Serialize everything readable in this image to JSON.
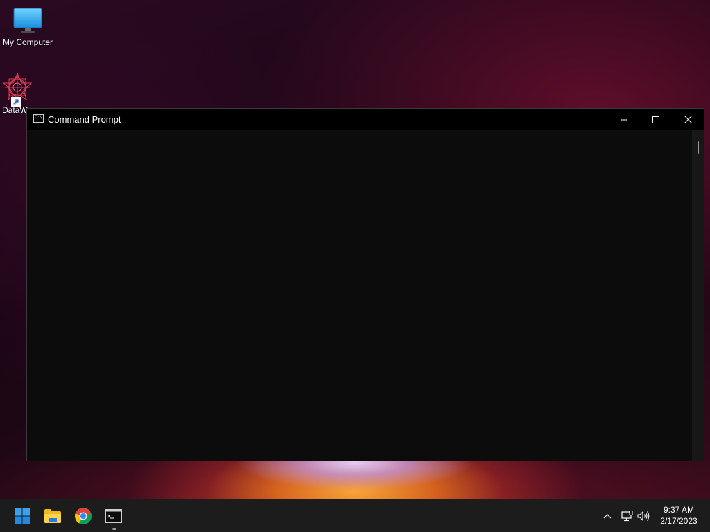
{
  "desktop": {
    "icons": [
      {
        "label": "My Computer",
        "icon": "monitor-icon"
      },
      {
        "label": "DataW",
        "icon": "datawarrior-icon"
      }
    ]
  },
  "window": {
    "title": "Command Prompt",
    "icon": "cmd-icon",
    "icon_text": "C:\\.",
    "buttons": {
      "minimize": "minimize-icon",
      "maximize": "maximize-icon",
      "close": "close-icon"
    }
  },
  "taskbar": {
    "items": [
      {
        "name": "Start",
        "icon": "windows-logo-icon"
      },
      {
        "name": "File Explorer",
        "icon": "folder-icon"
      },
      {
        "name": "Google Chrome",
        "icon": "chrome-icon"
      },
      {
        "name": "Command Prompt",
        "icon": "cmd-icon",
        "active": true
      }
    ],
    "tray": {
      "chevron": "chevron-up-icon",
      "network": "network-icon",
      "volume": "volume-icon"
    },
    "clock": {
      "time": "9:37 AM",
      "date": "2/17/2023"
    }
  },
  "colors": {
    "accent": "#0078d4",
    "console_bg": "#0c0c0c",
    "taskbar_bg": "#1c1c1c"
  }
}
